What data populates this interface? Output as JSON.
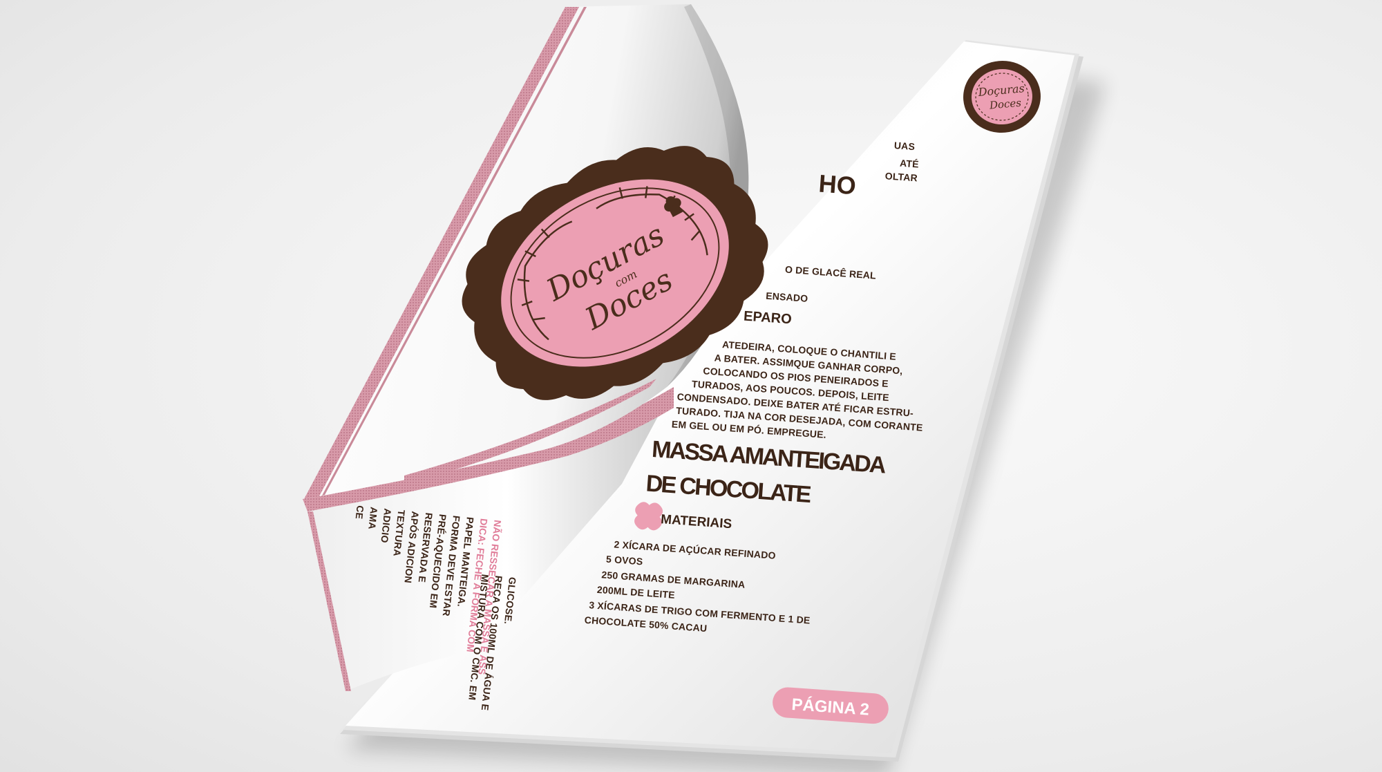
{
  "brand": {
    "logo_line1": "Doçuras",
    "logo_line2": "com",
    "logo_line3": "Doces"
  },
  "fragments": {
    "title_tail": "HO",
    "line_glace": "O DE GLACÊ REAL",
    "line_densado": "ENSADO",
    "preparo_tail": "EPARO",
    "top_right": [
      "UAS",
      "ATÉ",
      "OLTAR"
    ],
    "preparo_lines": [
      "ATEDEIRA, COLOQUE O CHANTILI E",
      "A BATER. ASSIMQUE GANHAR CORPO,",
      "COLOCANDO OS PIOS PENEIRADOS E",
      "TURADOS, AOS POUCOS. DEPOIS, LEITE",
      "CONDENSADO. DEIXE BATER ATÉ FICAR ESTRU-",
      "TURADO. TIJA NA COR DESEJADA, COM CORANTE",
      "EM GEL OU EM PÓ. EMPREGUE."
    ],
    "back_lines": [
      "CE",
      "AMA",
      "ADICIO",
      "TEXTURA",
      "APÓS ADICION",
      "RESERVADA E",
      "PRÉ-AQUECIDO EM",
      "FORMA DEVE ESTAR",
      "PAPEL MANTEIGA.",
      "MISTURA COM O CMC. EM",
      "REÇA OS 100ML DE ÁGUA E",
      "GLICOSE."
    ],
    "back_dica": [
      "DICA: FECHE A FORMA COM",
      "NÃO RESSECAR A MASSA E ASS"
    ]
  },
  "recipe": {
    "title_line1": "MASSA AMANTEIGADA",
    "title_line2": "DE CHOCOLATE",
    "section_label": "MATERIAIS",
    "ingredients": [
      "2 XÍCARA DE AÇÚCAR REFINADO",
      "5 OVOS",
      "250 GRAMAS DE MARGARINA",
      "200ML DE LEITE",
      "3 XÍCARAS DE TRIGO COM FERMENTO E 1 DE",
      "CHOCOLATE 50% CACAU"
    ]
  },
  "footer": {
    "page_label": "PÁGINA 2"
  },
  "colors": {
    "brown": "#4a2d1c",
    "pink": "#ec9fb3",
    "pink_light": "#f3b8c7",
    "stripe": "#c98a99"
  }
}
